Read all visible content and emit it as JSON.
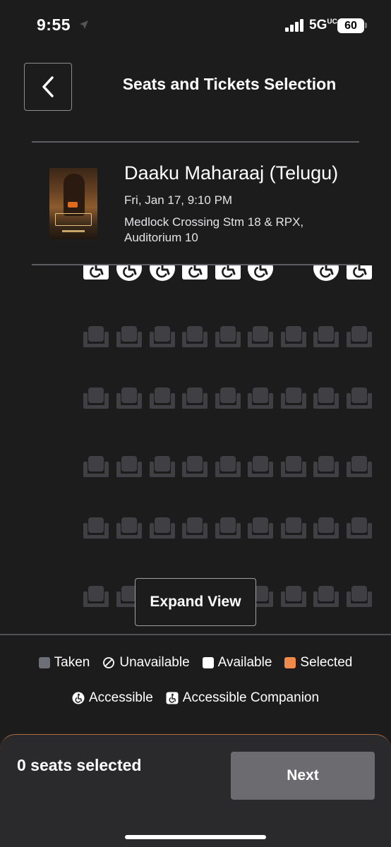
{
  "status_bar": {
    "time": "9:55",
    "network": "5G",
    "network_suffix": "UC",
    "battery": "60"
  },
  "header": {
    "title": "Seats and Tickets Selection",
    "back_icon": "chevron-left-icon"
  },
  "movie": {
    "title": "Daaku Maharaaj (Telugu)",
    "datetime": "Fri, Jan 17, 9:10 PM",
    "theater": "Medlock Crossing Stm 18 & RPX, Auditorium 10"
  },
  "seat_map": {
    "front_row": [
      "accessible-companion",
      "accessible",
      "accessible",
      "accessible-companion",
      "accessible-companion",
      "accessible",
      null,
      "accessible",
      "accessible-companion"
    ],
    "taken_rows": 5,
    "seats_per_row": 9,
    "seat_states": "taken",
    "colors": {
      "taken": "#404044",
      "available": "#ffffff",
      "selected": "#f08a4b"
    }
  },
  "expand_button": {
    "label": "Expand View"
  },
  "legend": {
    "taken": "Taken",
    "unavailable": "Unavailable",
    "available": "Available",
    "selected": "Selected",
    "accessible": "Accessible",
    "accessible_companion": "Accessible Companion"
  },
  "footer": {
    "seats_selected": "0 seats selected",
    "next_label": "Next"
  }
}
